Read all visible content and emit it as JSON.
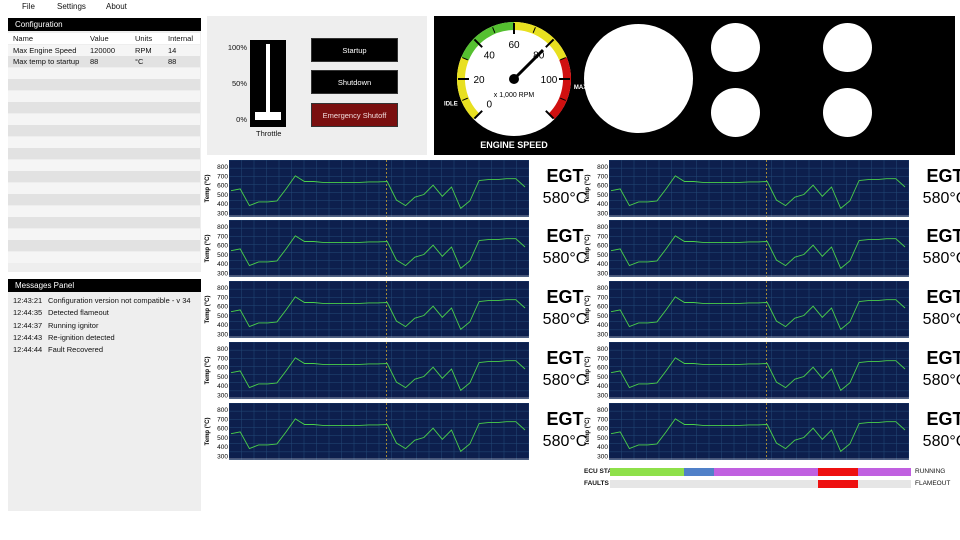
{
  "menu": [
    "File",
    "Settings",
    "About"
  ],
  "config": {
    "title": "Configuration",
    "columns": [
      "Name",
      "Value",
      "Units",
      "Internal"
    ],
    "rows": [
      [
        "Max Engine Speed",
        "120000",
        "RPM",
        "14"
      ],
      [
        "Max temp to startup",
        "88",
        "°C",
        "88"
      ]
    ]
  },
  "messages": {
    "title": "Messages Panel",
    "items": [
      {
        "time": "12:43:21",
        "text": "Configuration version not compatible - v 34"
      },
      {
        "time": "12:44:35",
        "text": "Detected flameout"
      },
      {
        "time": "12:44:37",
        "text": "Running ignitor"
      },
      {
        "time": "12:44:43",
        "text": "Re-ignition detected"
      },
      {
        "time": "12:44:44",
        "text": "Fault Recovered"
      }
    ]
  },
  "controls": {
    "throttle_label": "Throttle",
    "scale": [
      "100%",
      "50%",
      "0%"
    ],
    "throttle_level_percent": 0,
    "startup": "Startup",
    "shutdown": "Shutdown",
    "emergency": "Emergency Shutoff"
  },
  "gauge": {
    "title": "ENGINE SPEED",
    "unit": "x 1,000 RPM",
    "idle_label": "IDLE",
    "max_label": "MAX",
    "ticks": [
      "0",
      "20",
      "40",
      "60",
      "80",
      "100"
    ],
    "needle_value": 80,
    "range_max": 120,
    "colors": {
      "idle": "#55c030",
      "normal": "#e8e020",
      "max": "#d01010",
      "dial": "#ffffff",
      "panel": "#000000"
    }
  },
  "egt": {
    "title": "EGT",
    "value": "580°C",
    "ylabel": "Temp (°C)",
    "yticks": [
      "800",
      "700",
      "600",
      "500",
      "400",
      "300"
    ]
  },
  "chart_data": {
    "type": "line",
    "ylim": [
      300,
      850
    ],
    "series": [
      {
        "values": [
          540,
          560,
          380,
          420,
          420,
          430,
          560,
          700,
          640,
          640,
          630,
          630,
          630,
          630,
          630,
          635,
          635,
          640,
          440,
          380,
          470,
          500,
          600,
          480,
          580,
          350,
          430,
          650,
          660,
          660,
          670,
          670,
          580
        ]
      }
    ],
    "colors": {
      "background": "#0d1f4d",
      "grid": "#244a78",
      "line": "#4ad04a",
      "marker": "#c8a030"
    }
  },
  "status": {
    "ecu_label": "ECU STATE",
    "faults_label": "FAULTS",
    "ecu_right": "RUNNING",
    "faults_right": "FLAMEOUT",
    "ecu_segments": [
      {
        "share": 0.245,
        "color": "#8ee04a"
      },
      {
        "share": 0.1,
        "color": "#5080c8"
      },
      {
        "share": 0.345,
        "color": "#c060e0"
      },
      {
        "share": 0.135,
        "color": "#ee1010"
      },
      {
        "share": 0.175,
        "color": "#c060e0"
      }
    ],
    "fault_segments": [
      {
        "share": 0.69,
        "color": "#e6e6e6"
      },
      {
        "share": 0.135,
        "color": "#ee1010"
      },
      {
        "share": 0.175,
        "color": "#e6e6e6"
      }
    ]
  }
}
